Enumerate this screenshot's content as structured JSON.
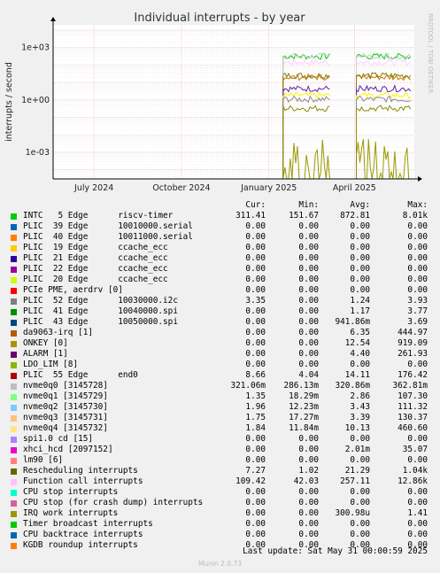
{
  "chart_data": {
    "type": "line",
    "title": "Individual interrupts - by year",
    "ylabel": "interrupts / second",
    "yscale": "log",
    "ylim": [
      3e-05,
      20000
    ],
    "yticks": [
      {
        "v": 0.001,
        "label": "1e-03"
      },
      {
        "v": 1,
        "label": "1e+00"
      },
      {
        "v": 1000,
        "label": "1e+03"
      }
    ],
    "x_range": [
      "2024-05-19",
      "2025-06-03"
    ],
    "xticks": [
      {
        "date": "2024-07-01",
        "label": "July 2024"
      },
      {
        "date": "2024-10-01",
        "label": "October 2024"
      },
      {
        "date": "2025-01-01",
        "label": "January 2025"
      },
      {
        "date": "2025-04-01",
        "label": "April 2025"
      }
    ],
    "grid": true,
    "segments": [
      [
        "2025-01-16",
        "2025-03-06"
      ],
      [
        "2025-04-03",
        "2025-05-30"
      ]
    ],
    "series_plotted": [
      {
        "name": "INTC 5 Edge",
        "color": "#00cc00",
        "y": 311.41
      },
      {
        "name": "Function call interrupts",
        "color": "#ffccff",
        "y": 140
      },
      {
        "name": "nvme0q0",
        "color": "#cccccc",
        "y": 321.06
      },
      {
        "name": "da9063-irq",
        "color": "#cc7700",
        "y": 20
      },
      {
        "name": "Rescheduling interrupts",
        "color": "#8a7a0b",
        "y": 25
      },
      {
        "name": "ALARM",
        "color": "#5c1fa3",
        "y": 4.4
      },
      {
        "name": "nvme0q4",
        "color": "#fff200",
        "y": 1.8
      },
      {
        "name": "PLIC 52 Edge",
        "color": "#888888",
        "y": 1.1
      },
      {
        "name": "PLIC 55 Edge",
        "color": "#8a8a00",
        "y": 0.33
      }
    ],
    "side_label": "RRDTOOL / TOBI OETIKER"
  },
  "legend": {
    "headers": [
      "Cur:",
      "Min:",
      "Avg:",
      "Max:"
    ],
    "rows": [
      {
        "name": "INTC   5 Edge      riscv-timer",
        "color": "#00cc00",
        "cur": "311.41",
        "min": "151.67",
        "avg": "872.81",
        "max": "8.01k"
      },
      {
        "name": "PLIC  39 Edge      10010000.serial",
        "color": "#0066b3",
        "cur": "0.00",
        "min": "0.00",
        "avg": "0.00",
        "max": "0.00"
      },
      {
        "name": "PLIC  40 Edge      10011000.serial",
        "color": "#ff8000",
        "cur": "0.00",
        "min": "0.00",
        "avg": "0.00",
        "max": "0.00"
      },
      {
        "name": "PLIC  19 Edge      ccache_ecc",
        "color": "#ffcc00",
        "cur": "0.00",
        "min": "0.00",
        "avg": "0.00",
        "max": "0.00"
      },
      {
        "name": "PLIC  21 Edge      ccache_ecc",
        "color": "#330099",
        "cur": "0.00",
        "min": "0.00",
        "avg": "0.00",
        "max": "0.00"
      },
      {
        "name": "PLIC  22 Edge      ccache_ecc",
        "color": "#990099",
        "cur": "0.00",
        "min": "0.00",
        "avg": "0.00",
        "max": "0.00"
      },
      {
        "name": "PLIC  20 Edge      ccache_ecc",
        "color": "#ccff00",
        "cur": "0.00",
        "min": "0.00",
        "avg": "0.00",
        "max": "0.00"
      },
      {
        "name": "PCIe PME, aerdrv [0]",
        "color": "#ff0000",
        "cur": "0.00",
        "min": "0.00",
        "avg": "0.00",
        "max": "0.00"
      },
      {
        "name": "PLIC  52 Edge      10030000.i2c",
        "color": "#808080",
        "cur": "3.35",
        "min": "0.00",
        "avg": "1.24",
        "max": "3.93"
      },
      {
        "name": "PLIC  41 Edge      10040000.spi",
        "color": "#008f00",
        "cur": "0.00",
        "min": "0.00",
        "avg": "1.17",
        "max": "3.77"
      },
      {
        "name": "PLIC  43 Edge      10050000.spi",
        "color": "#00487d",
        "cur": "0.00",
        "min": "0.00",
        "avg": "941.86m",
        "max": "3.69"
      },
      {
        "name": "da9063-irq [1]",
        "color": "#b35a00",
        "cur": "0.00",
        "min": "0.00",
        "avg": "6.35",
        "max": "444.97"
      },
      {
        "name": "ONKEY [0]",
        "color": "#b38f00",
        "cur": "0.00",
        "min": "0.00",
        "avg": "12.54",
        "max": "919.09"
      },
      {
        "name": "ALARM [1]",
        "color": "#6b006b",
        "cur": "0.00",
        "min": "0.00",
        "avg": "4.40",
        "max": "261.93"
      },
      {
        "name": "LDO_LIM [8]",
        "color": "#8fb300",
        "cur": "0.00",
        "min": "0.00",
        "avg": "0.00",
        "max": "0.00"
      },
      {
        "name": "PLIC  55 Edge      end0",
        "color": "#b30000",
        "cur": "8.66",
        "min": "4.04",
        "avg": "14.11",
        "max": "176.42"
      },
      {
        "name": "nvme0q0 [3145728]",
        "color": "#bebebe",
        "cur": "321.06m",
        "min": "286.13m",
        "avg": "320.86m",
        "max": "362.81m"
      },
      {
        "name": "nvme0q1 [3145729]",
        "color": "#80ff80",
        "cur": "1.35",
        "min": "18.29m",
        "avg": "2.86",
        "max": "107.30"
      },
      {
        "name": "nvme0q2 [3145730]",
        "color": "#80c9ff",
        "cur": "1.96",
        "min": "12.23m",
        "avg": "3.43",
        "max": "111.32"
      },
      {
        "name": "nvme0q3 [3145731]",
        "color": "#ffc080",
        "cur": "1.75",
        "min": "17.27m",
        "avg": "3.39",
        "max": "130.37"
      },
      {
        "name": "nvme0q4 [3145732]",
        "color": "#ffe680",
        "cur": "1.84",
        "min": "11.84m",
        "avg": "10.13",
        "max": "460.60"
      },
      {
        "name": "spi1.0 cd [15]",
        "color": "#aa80ff",
        "cur": "0.00",
        "min": "0.00",
        "avg": "0.00",
        "max": "0.00"
      },
      {
        "name": "xhci_hcd [2097152]",
        "color": "#ee00cc",
        "cur": "0.00",
        "min": "0.00",
        "avg": "2.01m",
        "max": "35.07"
      },
      {
        "name": "lm90 [6]",
        "color": "#ff8080",
        "cur": "0.00",
        "min": "0.00",
        "avg": "0.00",
        "max": "0.00"
      },
      {
        "name": "Rescheduling interrupts",
        "color": "#666600",
        "cur": "7.27",
        "min": "1.02",
        "avg": "21.29",
        "max": "1.04k"
      },
      {
        "name": "Function call interrupts",
        "color": "#ffbfff",
        "cur": "109.42",
        "min": "42.03",
        "avg": "257.11",
        "max": "12.86k"
      },
      {
        "name": "CPU stop interrupts",
        "color": "#00ffcc",
        "cur": "0.00",
        "min": "0.00",
        "avg": "0.00",
        "max": "0.00"
      },
      {
        "name": "CPU stop (for crash dump) interrupts",
        "color": "#cc6699",
        "cur": "0.00",
        "min": "0.00",
        "avg": "0.00",
        "max": "0.00"
      },
      {
        "name": "IRQ work interrupts",
        "color": "#999900",
        "cur": "0.00",
        "min": "0.00",
        "avg": "300.98u",
        "max": "1.41"
      },
      {
        "name": "Timer broadcast interrupts",
        "color": "#00cc00",
        "cur": "0.00",
        "min": "0.00",
        "avg": "0.00",
        "max": "0.00"
      },
      {
        "name": "CPU backtrace interrupts",
        "color": "#0066b3",
        "cur": "0.00",
        "min": "0.00",
        "avg": "0.00",
        "max": "0.00"
      },
      {
        "name": "KGDB roundup interrupts",
        "color": "#ff8000",
        "cur": "0.00",
        "min": "0.00",
        "avg": "0.00",
        "max": "0.00"
      }
    ]
  },
  "footer": {
    "last_update": "Last update: Sat May 31 00:00:59 2025",
    "munin": "Munin 2.0.73"
  }
}
